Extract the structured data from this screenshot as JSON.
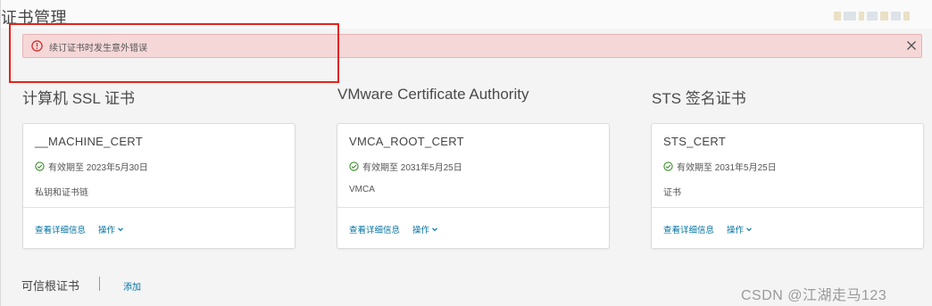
{
  "page": {
    "title": "证书管理"
  },
  "alert": {
    "message": "续订证书时发生意外错误",
    "icon": "error-circle-icon",
    "close_icon": "close-icon",
    "color": "#f6d7d7"
  },
  "sections": [
    {
      "title": "计算机 SSL 证书",
      "card": {
        "name": "__MACHINE_CERT",
        "validity": "有效期至 2023年5月30日",
        "description": "私钥和证书链",
        "details_label": "查看详细信息",
        "actions_label": "操作"
      }
    },
    {
      "title": "VMware Certificate Authority",
      "card": {
        "name": "VMCA_ROOT_CERT",
        "validity": "有效期至 2031年5月25日",
        "description": "VMCA",
        "details_label": "查看详细信息",
        "actions_label": "操作"
      }
    },
    {
      "title": "STS 签名证书",
      "card": {
        "name": "STS_CERT",
        "validity": "有效期至 2031年5月25日",
        "description": "证书",
        "details_label": "查看详细信息",
        "actions_label": "操作"
      }
    }
  ],
  "trusted": {
    "title": "可信根证书",
    "add_label": "添加"
  },
  "watermark": "CSDN @江湖走马123",
  "colors": {
    "link": "#0072a3",
    "valid_green": "#3c8b2e",
    "error_red": "#d0312d",
    "annotation_red": "#e2231a"
  }
}
